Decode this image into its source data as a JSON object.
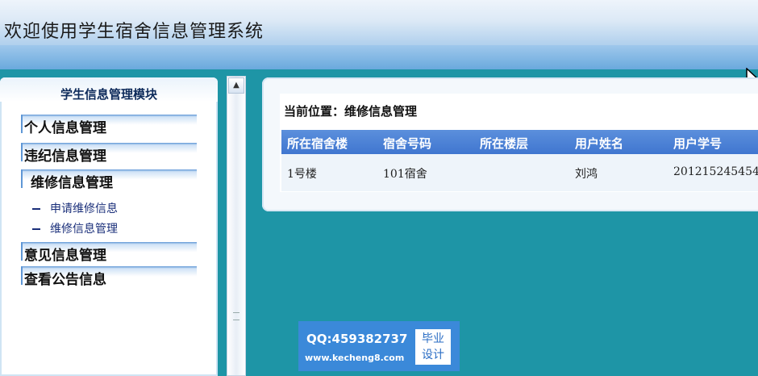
{
  "header": {
    "title": "欢迎使用学生宿舍信息管理系统"
  },
  "sidebar": {
    "title": "学生信息管理模块",
    "menu": [
      {
        "label": "个人信息管理"
      },
      {
        "label": "违纪信息管理"
      },
      {
        "label": "维修信息管理",
        "expanded": true,
        "children": [
          {
            "label": "申请维修信息"
          },
          {
            "label": "维修信息管理"
          }
        ]
      },
      {
        "label": "意见信息管理"
      },
      {
        "label": "查看公告信息"
      }
    ]
  },
  "main": {
    "location": "当前位置：维修信息管理",
    "table": {
      "headers": [
        "所在宿舍楼",
        "宿舍号码",
        "所在楼层",
        "用户姓名",
        "用户学号"
      ],
      "rows": [
        [
          "1号楼",
          "101宿舍",
          "",
          "刘鸿",
          "201215245454"
        ]
      ]
    }
  },
  "watermark": {
    "qq": "QQ:459382737",
    "url": "www.kecheng8.com",
    "badge_line1": "毕业",
    "badge_line2": "设计"
  },
  "colors": {
    "background": "#1e95a6",
    "table_header": "#4a80d6",
    "link": "#1a2f7a"
  }
}
